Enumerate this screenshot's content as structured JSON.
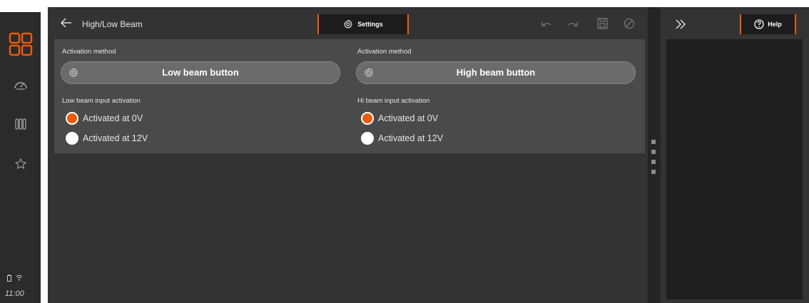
{
  "system": {
    "clock": "11:00"
  },
  "header": {
    "title": "High/Low Beam",
    "settings_tab_label": "Settings"
  },
  "cards": [
    {
      "activation_method_label": "Activation method",
      "button_label": "Low beam button",
      "input_activation_label": "Low beam input activation",
      "options": [
        {
          "label": "Activated at 0V",
          "selected": true
        },
        {
          "label": "Activated at 12V",
          "selected": false
        }
      ]
    },
    {
      "activation_method_label": "Activation method",
      "button_label": "High beam button",
      "input_activation_label": "Hi beam input activation",
      "options": [
        {
          "label": "Activated at 0V",
          "selected": true
        },
        {
          "label": "Activated at 12V",
          "selected": false
        }
      ]
    }
  ],
  "help_panel": {
    "tab_label": "Help"
  },
  "colors": {
    "accent": "#ea5b0c",
    "panel": "#333333",
    "card": "#4a4a4a",
    "rail": "#2b2b2b"
  },
  "icons": {
    "rail": [
      "apps-grid-icon",
      "speedometer-icon",
      "battery-cells-icon",
      "star-icon"
    ],
    "toolbar": [
      "undo-icon",
      "redo-icon",
      "save-icon",
      "disabled-icon"
    ]
  }
}
